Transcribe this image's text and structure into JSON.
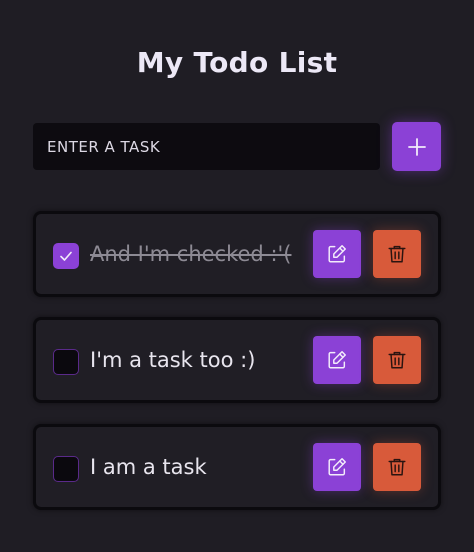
{
  "header": {
    "title": "My Todo List"
  },
  "new_task": {
    "placeholder": "ENTER A TASK",
    "value": ""
  },
  "add_button": {
    "icon": "plus-icon"
  },
  "colors": {
    "accent": "#8b41d6",
    "danger": "#d85a3a",
    "background": "#1f1d24"
  },
  "todos": [
    {
      "text": "And I'm checked :'(",
      "checked": true
    },
    {
      "text": "I'm a task too :)",
      "checked": false
    },
    {
      "text": "I am a task",
      "checked": false
    }
  ],
  "actions": {
    "edit_icon": "edit-icon",
    "delete_icon": "trash-icon"
  }
}
